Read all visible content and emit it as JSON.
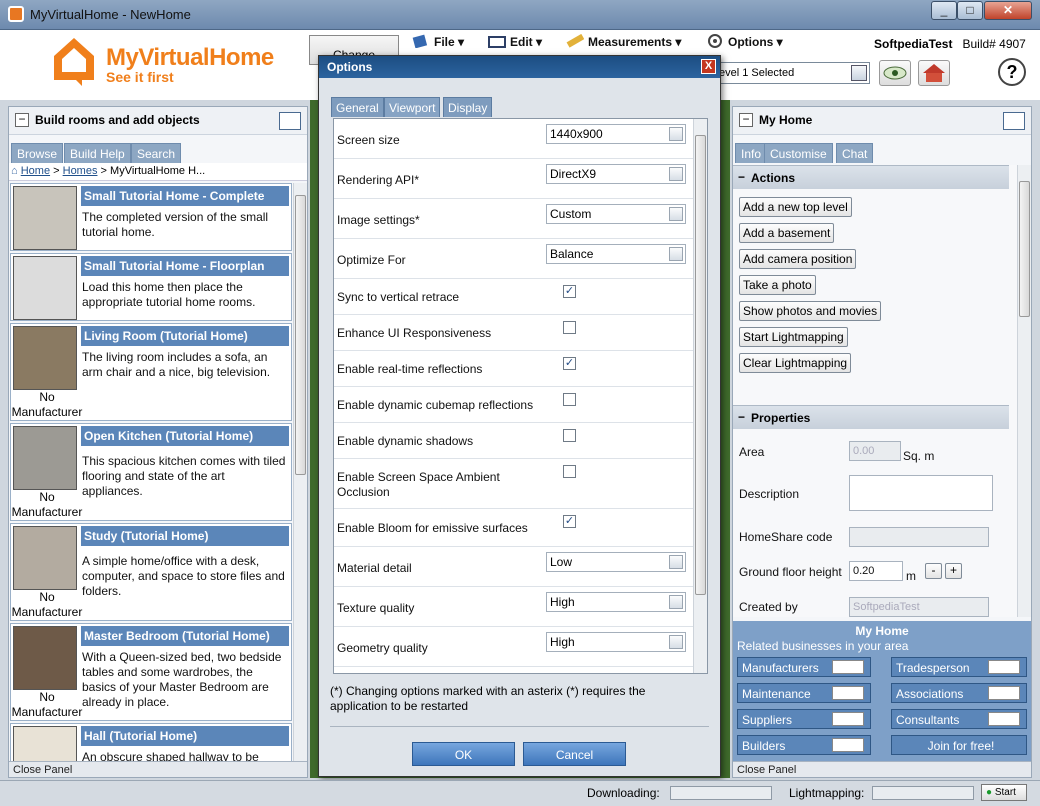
{
  "window": {
    "title": "MyVirtualHome - NewHome"
  },
  "brand": {
    "name": "MyVirtualHome",
    "tagline": "See it first",
    "color": "#f07f1b"
  },
  "menu": {
    "file": "File",
    "edit": "Edit",
    "measurements": "Measurements",
    "options": "Options"
  },
  "user": {
    "name": "SoftpediaTest",
    "build": "Build# 4907"
  },
  "toolbar": {
    "change_label": "Change",
    "level_selected": "evel 1 Selected",
    "help": "?"
  },
  "left_panel": {
    "title": "Build rooms and add objects",
    "tabs": [
      "Browse",
      "Build Help",
      "Search"
    ],
    "breadcrumb": {
      "home": "Home",
      "sep1": ">",
      "homes": "Homes",
      "sep2": ">",
      "current": "MyVirtualHome H..."
    },
    "items": [
      {
        "title": "Small Tutorial Home - Complete",
        "desc": "The completed version of the small tutorial home.",
        "maker": ""
      },
      {
        "title": "Small Tutorial Home - Floorplan",
        "desc": "Load this home then place the appropriate tutorial home rooms.",
        "maker": ""
      },
      {
        "title": "Living Room (Tutorial Home)",
        "desc": "The living room includes a sofa, an arm chair and a nice, big television.",
        "maker": "No Manufacturer"
      },
      {
        "title": "Open Kitchen (Tutorial Home)",
        "desc": "This spacious kitchen comes with tiled flooring and state of the art appliances.",
        "maker": "No Manufacturer"
      },
      {
        "title": "Study (Tutorial Home)",
        "desc": "A simple home/office with a desk, computer, and space to store files and folders.",
        "maker": "No Manufacturer"
      },
      {
        "title": "Master Bedroom (Tutorial Home)",
        "desc": "With a Queen-sized bed, two bedside tables and some wardrobes, the basics of your Master Bedroom are already in place.",
        "maker": "No Manufacturer"
      },
      {
        "title": "Hall (Tutorial Home)",
        "desc": "An obscure shaped hallway to be",
        "maker": ""
      }
    ],
    "close_label": "Close Panel"
  },
  "right_panel": {
    "title": "My Home",
    "tabs": [
      "Info",
      "Customise",
      "Chat"
    ],
    "actions_header": "Actions",
    "actions": [
      "Add a new top level",
      "Add a basement",
      "Add camera position",
      "Take a photo",
      "Show photos and movies",
      "Start Lightmapping",
      "Clear Lightmapping"
    ],
    "properties_header": "Properties",
    "props": {
      "area_label": "Area",
      "area_value": "0.00",
      "area_unit": "Sq. m",
      "description_label": "Description",
      "homeshare_label": "HomeShare code",
      "ground_label": "Ground floor height",
      "ground_value": "0.20",
      "ground_unit": "m",
      "minus": "-",
      "plus": "+",
      "created_label": "Created by",
      "created_value": "SoftpediaTest"
    },
    "biz": {
      "title": "My Home",
      "subtitle": "Related businesses in your area",
      "left": [
        "Manufacturers",
        "Maintenance",
        "Suppliers",
        "Builders"
      ],
      "right": [
        "Tradesperson",
        "Associations",
        "Consultants"
      ],
      "join": "Join for free!"
    },
    "close_label": "Close Panel"
  },
  "dialog": {
    "title": "Options",
    "close": "X",
    "tabs": [
      "General",
      "Viewport",
      "Display"
    ],
    "selects": [
      {
        "label": "Screen size",
        "value": "1440x900"
      },
      {
        "label": "Rendering API*",
        "value": "DirectX9"
      },
      {
        "label": "Image settings*",
        "value": "Custom"
      },
      {
        "label": "Optimize For",
        "value": "Balance"
      }
    ],
    "checks": [
      {
        "label": "Sync to vertical retrace",
        "mark": "✓"
      },
      {
        "label": "Enhance UI Responsiveness",
        "mark": ""
      },
      {
        "label": "Enable real-time reflections",
        "mark": "✓"
      },
      {
        "label": "Enable dynamic cubemap reflections",
        "mark": ""
      },
      {
        "label": "Enable dynamic shadows",
        "mark": ""
      },
      {
        "label": "Enable Screen Space Ambient Occlusion",
        "mark": ""
      },
      {
        "label": "Enable Bloom for emissive surfaces",
        "mark": "✓"
      }
    ],
    "selects2": [
      {
        "label": "Material detail",
        "value": "Low"
      },
      {
        "label": "Texture quality",
        "value": "High"
      },
      {
        "label": "Geometry quality",
        "value": "High"
      }
    ],
    "note": "(*) Changing options marked with an asterix (*) requires the application to be restarted",
    "ok": "OK",
    "cancel": "Cancel"
  },
  "status": {
    "downloading": "Downloading:",
    "lightmapping": "Lightmapping:",
    "start": "Start"
  }
}
